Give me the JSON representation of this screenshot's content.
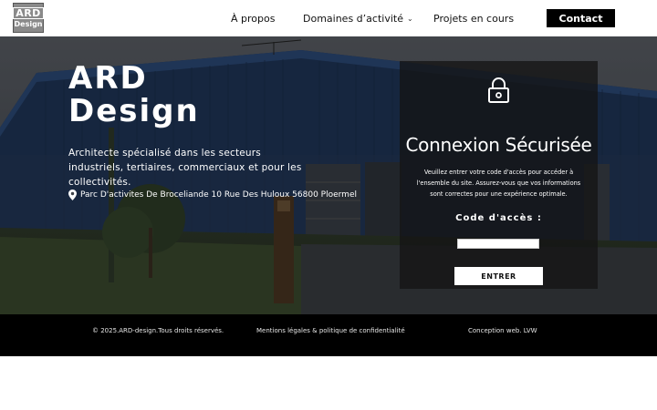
{
  "header": {
    "logo_line1": "ARD",
    "logo_line2": "Design",
    "nav": [
      {
        "label": "À propos"
      },
      {
        "label": "Domaines d’activité"
      },
      {
        "label": "Projets en cours"
      }
    ],
    "contact_label": "Contact"
  },
  "hero": {
    "title_line1": "ARD",
    "title_line2": "Design",
    "description": "Architecte spécialisé dans les secteurs industriels, tertiaires, commerciaux et pour les collectivités.",
    "address": "Parc D'activites De Broceliande 10 Rue Des Huloux 56800 Ploermel",
    "address_icon": "map-pin-icon"
  },
  "login": {
    "icon": "lock-icon",
    "title": "Connexion Sécurisée",
    "text": "Veuillez entrer votre code d'accès pour accéder à l'ensemble du site. Assurez-vous que vos informations sont correctes pour une expérience optimale.",
    "label": "Code d'accès :",
    "input_value": "",
    "button_label": "ENTRER"
  },
  "footer": {
    "copyright": "© 2025.ARD-design.Tous droits réservés.",
    "legal": "Mentions légales & politique de confidentialité",
    "credit": "Conception web. LVW"
  },
  "colors": {
    "header_bg": "#ffffff",
    "contact_bg": "#000000",
    "panel_bg": "#141414",
    "footer_bg": "#000000",
    "building_blue": "#27446e"
  }
}
